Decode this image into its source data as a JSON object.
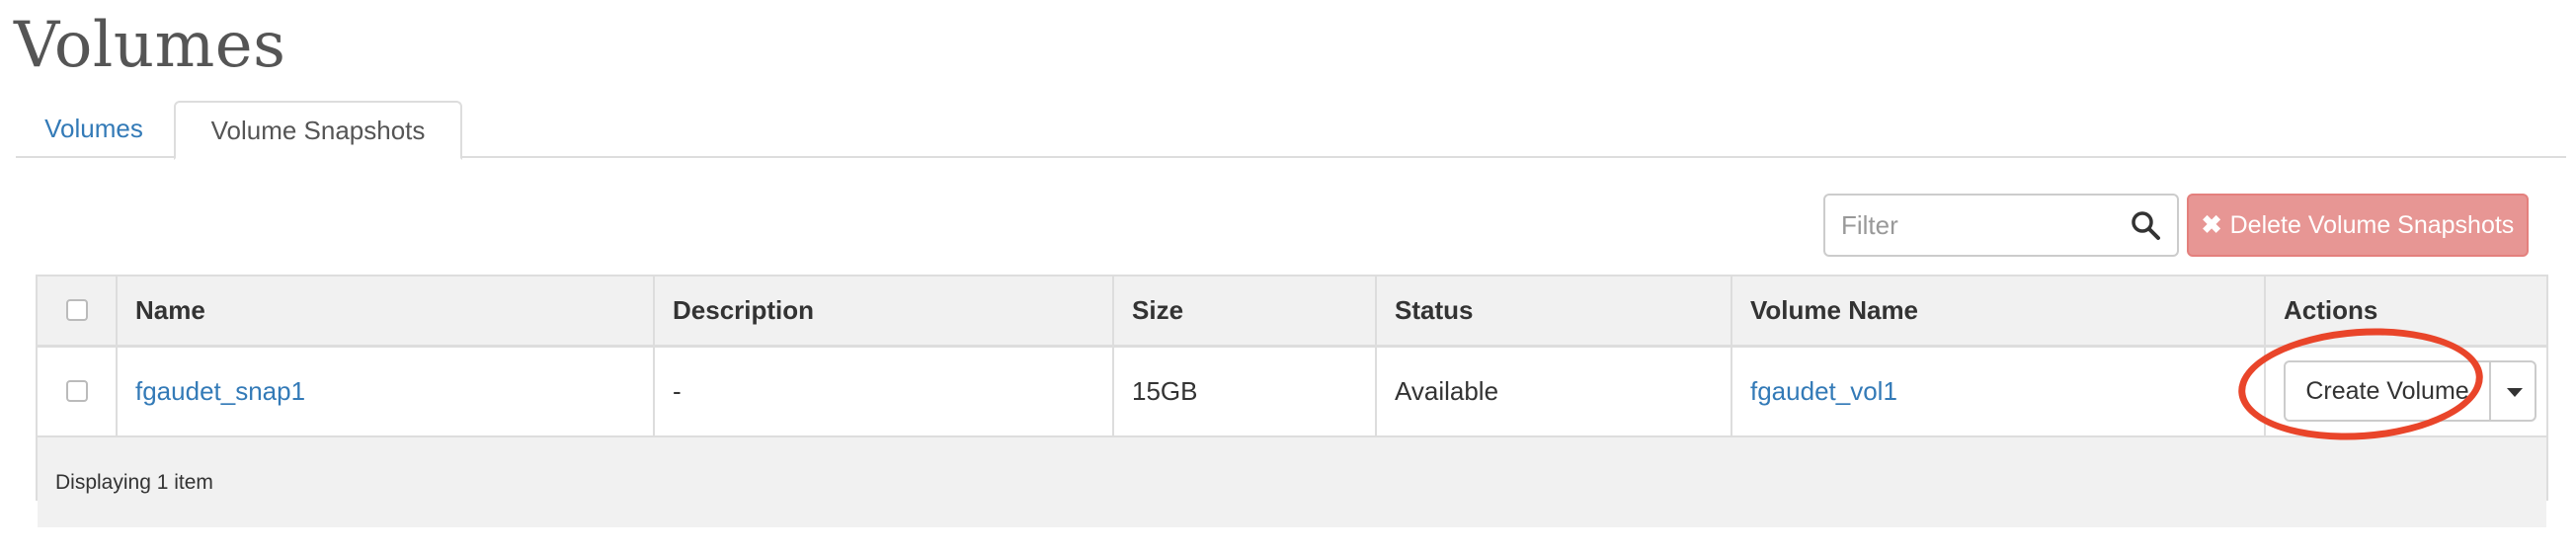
{
  "page": {
    "title": "Volumes"
  },
  "tabs": [
    {
      "label": "Volumes",
      "active": false
    },
    {
      "label": "Volume Snapshots",
      "active": true
    }
  ],
  "toolbar": {
    "filter_placeholder": "Filter",
    "search_icon": "search-icon",
    "delete_icon": "close-icon",
    "delete_label": "Delete Volume Snapshots",
    "delete_color": "#e79694"
  },
  "table": {
    "headers": [
      "Name",
      "Description",
      "Size",
      "Status",
      "Volume Name",
      "Actions"
    ],
    "rows": [
      {
        "name": "fgaudet_snap1",
        "description": "-",
        "size": "15GB",
        "status": "Available",
        "volume_name": "fgaudet_vol1",
        "action_label": "Create Volume"
      }
    ],
    "footer": "Displaying 1 item"
  },
  "annotation": {
    "color": "#e9452a"
  }
}
